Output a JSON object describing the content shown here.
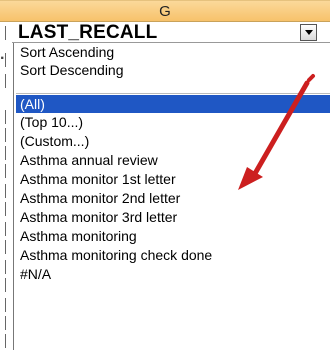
{
  "column": {
    "letter": "G"
  },
  "header_cell": {
    "title": "LAST_RECALL"
  },
  "filter_menu": {
    "sort_items": [
      "Sort Ascending",
      "Sort Descending"
    ],
    "selected_item": "(All)",
    "items": [
      "(Top 10...)",
      "(Custom...)",
      "Asthma annual review",
      "Asthma monitor 1st letter",
      "Asthma monitor 2nd letter",
      "Asthma monitor 3rd letter",
      "Asthma monitoring",
      "Asthma monitoring check done",
      "#N/A"
    ]
  },
  "annotation": {
    "arrow_color": "#cc1f1f"
  },
  "colors": {
    "selection": "#1f57c4",
    "column_header": "#f7c26b"
  }
}
